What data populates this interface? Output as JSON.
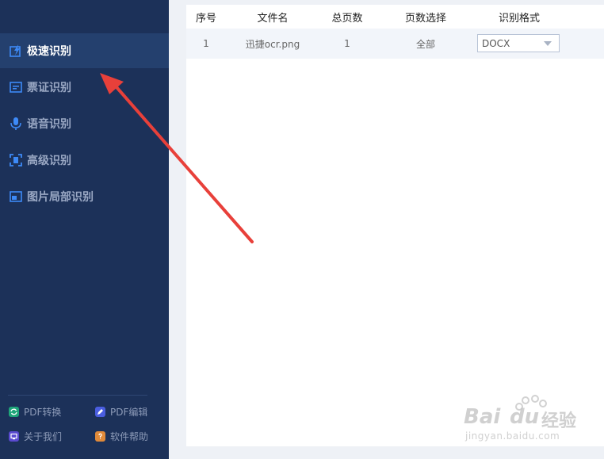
{
  "sidebar": {
    "items": [
      {
        "label": "极速识别",
        "icon": "lightning-doc-icon",
        "active": true
      },
      {
        "label": "票证识别",
        "icon": "ticket-icon",
        "active": false
      },
      {
        "label": "语音识别",
        "icon": "microphone-icon",
        "active": false
      },
      {
        "label": "高级识别",
        "icon": "scan-frame-icon",
        "active": false
      },
      {
        "label": "图片局部识别",
        "icon": "image-crop-icon",
        "active": false
      }
    ],
    "bottom_links": [
      {
        "label": "PDF转换",
        "icon": "pdf-convert-icon",
        "color": "#1fa67a"
      },
      {
        "label": "PDF编辑",
        "icon": "pdf-edit-icon",
        "color": "#4a5ee0"
      },
      {
        "label": "关于我们",
        "icon": "about-icon",
        "color": "#5a4ad0"
      },
      {
        "label": "软件帮助",
        "icon": "help-icon",
        "color": "#e08a3a"
      }
    ]
  },
  "table": {
    "headers": [
      "序号",
      "文件名",
      "总页数",
      "页数选择",
      "识别格式"
    ],
    "rows": [
      {
        "index": "1",
        "filename": "迅捷ocr.png",
        "total_pages": "1",
        "page_selection": "全部",
        "format": "DOCX"
      }
    ]
  },
  "watermark": {
    "brand": "Bai",
    "brand2": "du",
    "suffix": "经验",
    "url": "jingyan.baidu.com"
  },
  "colors": {
    "sidebar_bg": "#1c3159",
    "active_bg": "#24406e",
    "accent": "#3d8af7",
    "arrow": "#e8403a"
  }
}
